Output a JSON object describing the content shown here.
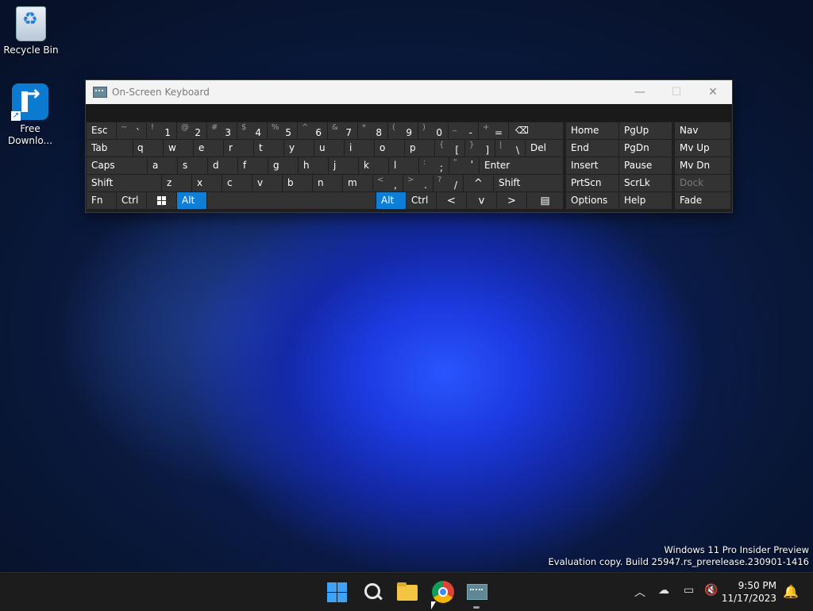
{
  "desktop": {
    "icons": [
      {
        "label": "Recycle Bin",
        "icon": "recycle-bin-icon"
      },
      {
        "label": "Free Downlo...",
        "label_lines": [
          "Free",
          "Downlo..."
        ],
        "icon": "free-download-manager-icon"
      }
    ]
  },
  "osk": {
    "title": "On-Screen Keyboard",
    "accent": "#0f7ed6",
    "rows": {
      "row1": [
        {
          "label": "Esc"
        },
        {
          "shift": "~",
          "main": "`"
        },
        {
          "shift": "!",
          "main": "1"
        },
        {
          "shift": "@",
          "main": "2"
        },
        {
          "shift": "#",
          "main": "3"
        },
        {
          "shift": "$",
          "main": "4"
        },
        {
          "shift": "%",
          "main": "5"
        },
        {
          "shift": "^",
          "main": "6"
        },
        {
          "shift": "&",
          "main": "7"
        },
        {
          "shift": "*",
          "main": "8"
        },
        {
          "shift": "(",
          "main": "9"
        },
        {
          "shift": ")",
          "main": "0"
        },
        {
          "shift": "_",
          "main": "-"
        },
        {
          "shift": "+",
          "main": "="
        },
        {
          "icon": "backspace-icon"
        }
      ],
      "row2": [
        {
          "label": "Tab"
        },
        {
          "label": "q"
        },
        {
          "label": "w"
        },
        {
          "label": "e"
        },
        {
          "label": "r"
        },
        {
          "label": "t"
        },
        {
          "label": "y"
        },
        {
          "label": "u"
        },
        {
          "label": "i"
        },
        {
          "label": "o"
        },
        {
          "label": "p"
        },
        {
          "shift": "{",
          "main": "["
        },
        {
          "shift": "}",
          "main": "]"
        },
        {
          "shift": "|",
          "main": "\\"
        },
        {
          "label": "Del"
        }
      ],
      "row3": [
        {
          "label": "Caps"
        },
        {
          "label": "a"
        },
        {
          "label": "s"
        },
        {
          "label": "d"
        },
        {
          "label": "f"
        },
        {
          "label": "g"
        },
        {
          "label": "h"
        },
        {
          "label": "j"
        },
        {
          "label": "k"
        },
        {
          "label": "l"
        },
        {
          "shift": ":",
          "main": ";"
        },
        {
          "shift": "\"",
          "main": "'"
        },
        {
          "label": "Enter"
        }
      ],
      "row4": [
        {
          "label": "Shift"
        },
        {
          "label": "z"
        },
        {
          "label": "x"
        },
        {
          "label": "c"
        },
        {
          "label": "v"
        },
        {
          "label": "b"
        },
        {
          "label": "n"
        },
        {
          "label": "m"
        },
        {
          "shift": "<",
          "main": ","
        },
        {
          "shift": ">",
          "main": "."
        },
        {
          "shift": "?",
          "main": "/"
        },
        {
          "icon": "arrow-up-icon",
          "glyph": "^"
        },
        {
          "label": "Shift"
        }
      ],
      "row5": [
        {
          "label": "Fn"
        },
        {
          "label": "Ctrl"
        },
        {
          "icon": "windows-logo-icon"
        },
        {
          "label": "Alt",
          "active": true
        },
        {
          "label": ""
        },
        {
          "label": "Alt",
          "active": true
        },
        {
          "label": "Ctrl"
        },
        {
          "icon": "arrow-left-icon",
          "glyph": "<"
        },
        {
          "icon": "arrow-down-icon",
          "glyph": "v"
        },
        {
          "icon": "arrow-right-icon",
          "glyph": ">"
        },
        {
          "icon": "context-menu-icon"
        }
      ]
    },
    "nav_keys": [
      [
        "Home",
        "PgUp",
        "Nav"
      ],
      [
        "End",
        "PgDn",
        "Mv Up"
      ],
      [
        "Insert",
        "Pause",
        "Mv Dn"
      ],
      [
        "PrtScn",
        "ScrLk",
        "Dock"
      ],
      [
        "Options",
        "Help",
        "Fade"
      ]
    ]
  },
  "watermark": {
    "line1": "Windows 11 Pro Insider Preview",
    "line2": "Evaluation copy. Build 25947.rs_prerelease.230901-1416"
  },
  "taskbar": {
    "apps": [
      "start-icon",
      "search-icon",
      "file-explorer-icon",
      "chrome-icon",
      "on-screen-keyboard-icon"
    ],
    "clock": {
      "time": "9:50 PM",
      "date": "11/17/2023"
    }
  }
}
